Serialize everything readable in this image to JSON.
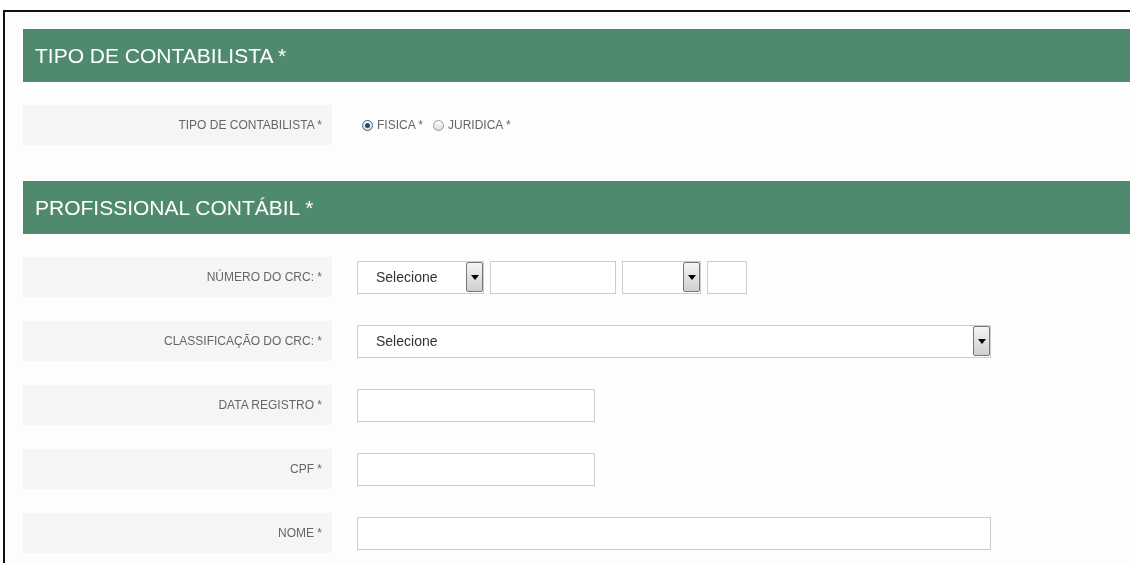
{
  "sections": [
    {
      "title": "TIPO DE CONTABILISTA *",
      "rows": [
        {
          "label": "TIPO DE CONTABILISTA *",
          "kind": "radio",
          "options": [
            {
              "label": "FISICA *",
              "selected": true
            },
            {
              "label": "JURIDICA *",
              "selected": false
            }
          ]
        }
      ]
    },
    {
      "title": "PROFISSIONAL CONTÁBIL *",
      "rows": [
        {
          "label": "NÚMERO DO CRC: *",
          "kind": "fields",
          "controls": [
            {
              "kind": "select",
              "value": "Selecione"
            },
            {
              "kind": "input"
            },
            {
              "kind": "select"
            },
            {
              "kind": "input"
            }
          ]
        },
        {
          "label": "CLASSIFICAÇÃO DO CRC: *",
          "kind": "fields",
          "controls": [
            {
              "kind": "select",
              "value": "Selecione"
            }
          ]
        },
        {
          "label": "DATA REGISTRO *",
          "kind": "fields",
          "controls": [
            {
              "kind": "input"
            }
          ]
        },
        {
          "label": "CPF *",
          "kind": "fields",
          "controls": [
            {
              "kind": "input"
            }
          ]
        },
        {
          "label": "NOME *",
          "kind": "fields",
          "controls": [
            {
              "kind": "input"
            }
          ]
        }
      ]
    }
  ]
}
